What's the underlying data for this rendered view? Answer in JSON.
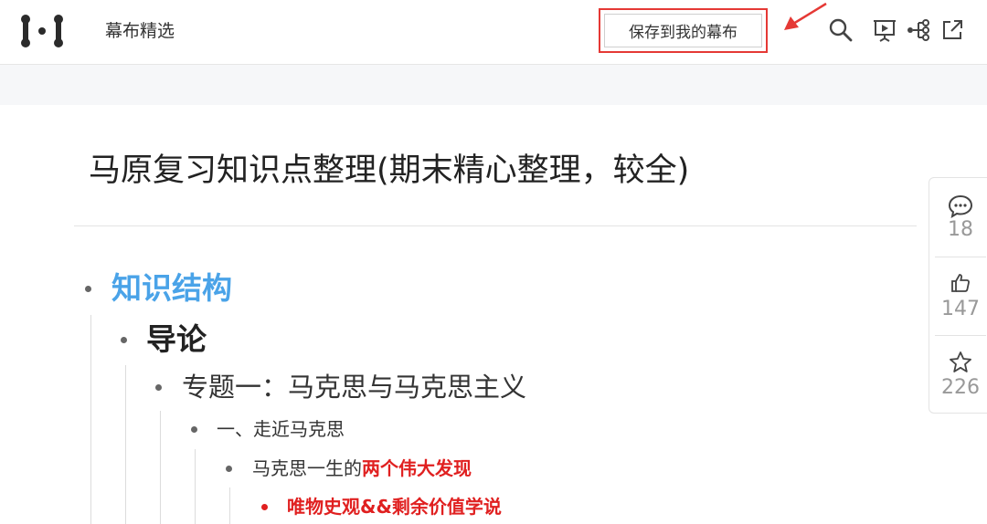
{
  "header": {
    "brand": "幕布精选",
    "save_button": "保存到我的幕布",
    "icons": [
      "logo-icon",
      "search-icon",
      "present-icon",
      "mindmap-icon",
      "share-external-icon"
    ],
    "annotation_color": "#e53935"
  },
  "document": {
    "title": "马原复习知识点整理(期末精心整理，较全)",
    "outline": {
      "l1": "知识结构",
      "l2": "导论",
      "l3": "专题一：马克思与马克思主义",
      "l4": "一、走近马克思",
      "l5_prefix": "马克思一生的",
      "l5_highlight": "两个伟大发现",
      "l6": "唯物史观&&剩余价值学说"
    },
    "colors": {
      "heading_blue": "#4aa3e8",
      "highlight_red": "#e02020"
    }
  },
  "sidebar": {
    "comments": "18",
    "likes": "147",
    "stars": "226"
  }
}
